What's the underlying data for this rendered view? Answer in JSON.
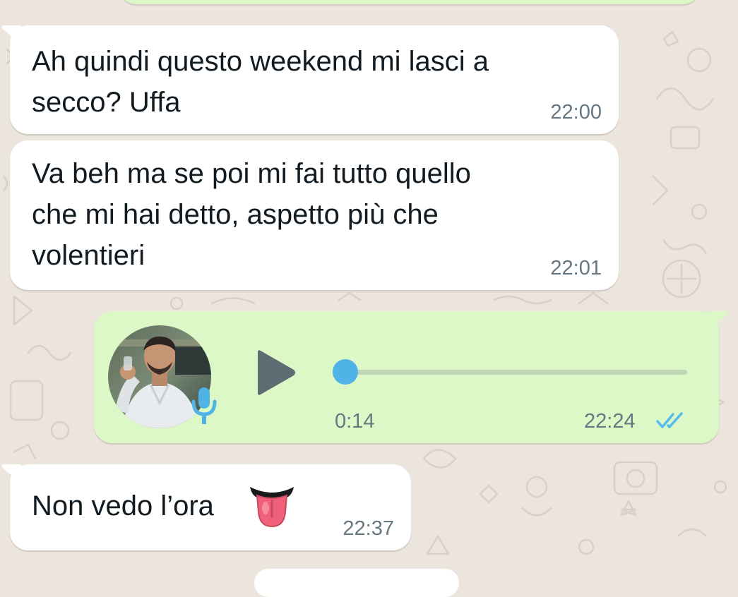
{
  "chat": {
    "messages": [
      {
        "direction": "incoming",
        "text": "Ah quindi questo weekend mi lasci a\nsecco? Uffa",
        "time": "22:00"
      },
      {
        "direction": "incoming",
        "text": "Va beh ma se poi mi fai tutto quello\nche mi hai detto, aspetto più che\nvolentieri",
        "time": "22:01"
      },
      {
        "direction": "outgoing",
        "type": "voice",
        "duration": "0:14",
        "time": "22:24",
        "status_icon": "double-check-read-icon",
        "play_icon": "play-icon",
        "mic_icon": "microphone-icon",
        "progress": 0,
        "avatar": "sender-avatar-photo"
      },
      {
        "direction": "incoming",
        "text": "Non vedo l’ora",
        "emoji": "tongue-face-icon",
        "time": "22:37"
      }
    ]
  },
  "colors": {
    "wallpaper": "#ece5dd",
    "incoming_bubble": "#ffffff",
    "outgoing_bubble": "#dcf8c6",
    "time_text": "#667781",
    "read_ticks": "#53bdeb",
    "play_button": "#5f6b72",
    "voice_dot": "#4fb3e8",
    "mic": "#4fb3e8"
  }
}
